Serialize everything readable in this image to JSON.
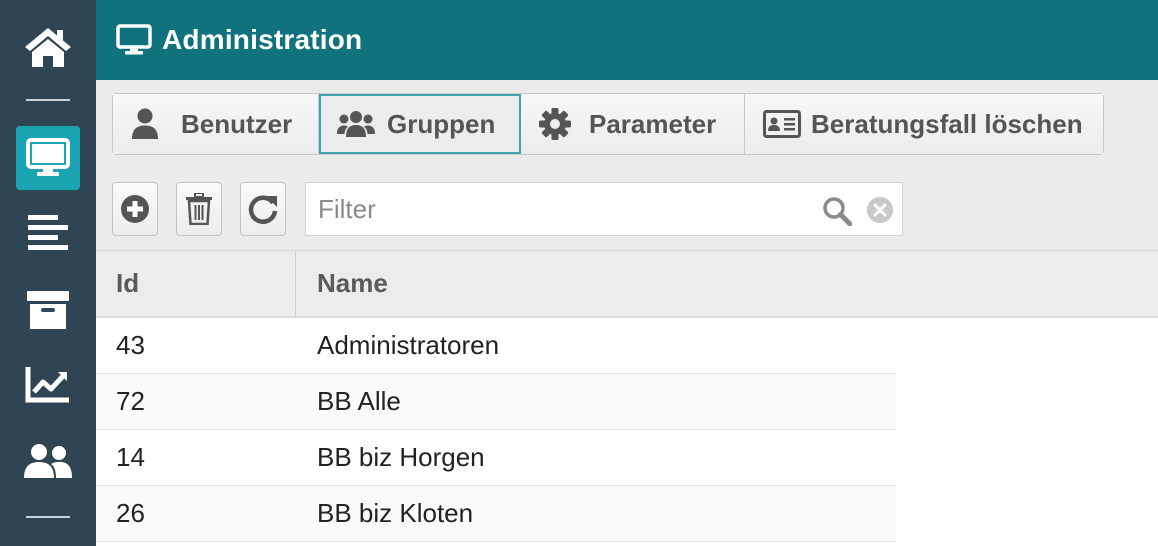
{
  "header": {
    "title": "Administration",
    "icon": "monitor-icon"
  },
  "sidebar": {
    "items": [
      {
        "name": "home",
        "icon": "home-icon",
        "active": false
      },
      {
        "name": "administration",
        "icon": "monitor-icon",
        "active": true
      },
      {
        "name": "list",
        "icon": "align-left-icon",
        "active": false
      },
      {
        "name": "archive",
        "icon": "archive-icon",
        "active": false
      },
      {
        "name": "statistics",
        "icon": "chart-line-icon",
        "active": false
      },
      {
        "name": "users",
        "icon": "users-icon",
        "active": false
      }
    ]
  },
  "tabs": [
    {
      "label": "Benutzer",
      "icon": "user-icon",
      "active": false
    },
    {
      "label": "Gruppen",
      "icon": "users-icon",
      "active": true
    },
    {
      "label": "Parameter",
      "icon": "gear-icon",
      "active": false
    },
    {
      "label": "Beratungsfall löschen",
      "icon": "id-card-icon",
      "active": false
    }
  ],
  "toolbar": {
    "add_icon": "plus-circle-icon",
    "delete_icon": "trash-icon",
    "refresh_icon": "refresh-icon",
    "filter_placeholder": "Filter",
    "filter_value": ""
  },
  "table": {
    "columns": [
      "Id",
      "Name"
    ],
    "rows": [
      {
        "id": "43",
        "name": "Administratoren"
      },
      {
        "id": "72",
        "name": "BB Alle"
      },
      {
        "id": "14",
        "name": "BB biz Horgen"
      },
      {
        "id": "26",
        "name": "BB biz Kloten"
      }
    ]
  },
  "colors": {
    "sidebar": "#2f4553",
    "header": "#0f727c",
    "active": "#1aa3b3",
    "tab_active_border": "#3fa4ab"
  }
}
